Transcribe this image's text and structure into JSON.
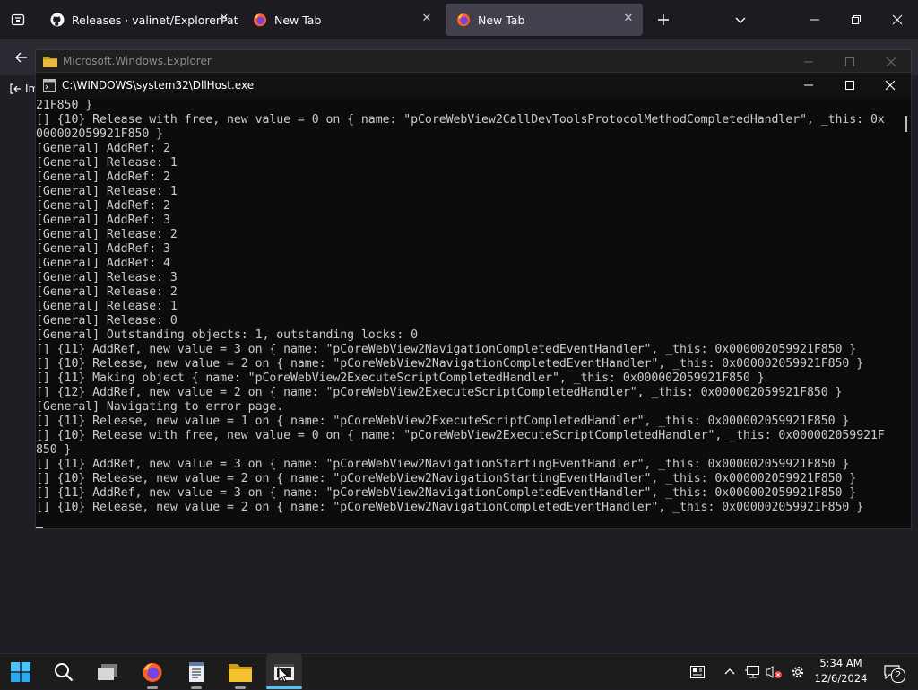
{
  "browser": {
    "tabs": [
      {
        "title": "Releases · valinet/ExplorerPatcher",
        "icon": "github-icon",
        "active": false
      },
      {
        "title": "New Tab",
        "icon": "firefox-icon",
        "active": false
      },
      {
        "title": "New Tab",
        "icon": "firefox-icon",
        "active": true
      }
    ],
    "toolbar_partial_label": "Im"
  },
  "explorer_window": {
    "title": "Microsoft.Windows.Explorer"
  },
  "console_window": {
    "title": "C:\\WINDOWS\\system32\\DllHost.exe",
    "lines": [
      "21F850 }",
      "[] {10} Release with free, new value = 0 on { name: \"pCoreWebView2CallDevToolsProtocolMethodCompletedHandler\", _this: 0x",
      "000002059921F850 }",
      "[General] AddRef: 2",
      "[General] Release: 1",
      "[General] AddRef: 2",
      "[General] Release: 1",
      "[General] AddRef: 2",
      "[General] AddRef: 3",
      "[General] Release: 2",
      "[General] AddRef: 3",
      "[General] AddRef: 4",
      "[General] Release: 3",
      "[General] Release: 2",
      "[General] Release: 1",
      "[General] Release: 0",
      "[General] Outstanding objects: 1, outstanding locks: 0",
      "[] {11} AddRef, new value = 3 on { name: \"pCoreWebView2NavigationCompletedEventHandler\", _this: 0x000002059921F850 }",
      "[] {10} Release, new value = 2 on { name: \"pCoreWebView2NavigationCompletedEventHandler\", _this: 0x000002059921F850 }",
      "[] {11} Making object { name: \"pCoreWebView2ExecuteScriptCompletedHandler\", _this: 0x000002059921F850 }",
      "[] {12} AddRef, new value = 2 on { name: \"pCoreWebView2ExecuteScriptCompletedHandler\", _this: 0x000002059921F850 }",
      "[General] Navigating to error page.",
      "[] {11} Release, new value = 1 on { name: \"pCoreWebView2ExecuteScriptCompletedHandler\", _this: 0x000002059921F850 }",
      "[] {10} Release with free, new value = 0 on { name: \"pCoreWebView2ExecuteScriptCompletedHandler\", _this: 0x000002059921F",
      "850 }",
      "[] {11} AddRef, new value = 3 on { name: \"pCoreWebView2NavigationStartingEventHandler\", _this: 0x000002059921F850 }",
      "[] {10} Release, new value = 2 on { name: \"pCoreWebView2NavigationStartingEventHandler\", _this: 0x000002059921F850 }",
      "[] {11} AddRef, new value = 3 on { name: \"pCoreWebView2NavigationCompletedEventHandler\", _this: 0x000002059921F850 }",
      "[] {10} Release, new value = 2 on { name: \"pCoreWebView2NavigationCompletedEventHandler\", _this: 0x000002059921F850 }"
    ]
  },
  "taskbar": {
    "apps": [
      {
        "name": "start-button",
        "icon": "windows-logo-icon",
        "running": false,
        "active": false
      },
      {
        "name": "search-button",
        "icon": "search-icon",
        "running": false,
        "active": false
      },
      {
        "name": "task-view-button",
        "icon": "task-view-icon",
        "running": false,
        "active": false
      },
      {
        "name": "firefox-taskbar-button",
        "icon": "firefox-icon",
        "running": true,
        "active": false
      },
      {
        "name": "notepad-taskbar-button",
        "icon": "document-app-icon",
        "running": true,
        "active": false
      },
      {
        "name": "file-explorer-taskbar-button",
        "icon": "folder-icon",
        "running": true,
        "active": false
      },
      {
        "name": "console-taskbar-button",
        "icon": "console-app-icon",
        "running": true,
        "active": true
      }
    ],
    "clock": {
      "time": "5:34 AM",
      "date": "12/6/2024"
    },
    "notification_count": "2"
  },
  "colors": {
    "accent": "#4cc2ff",
    "console_background": "#0c0c0c",
    "console_text": "#cccccc",
    "browser_tab_active": "#42414d"
  }
}
